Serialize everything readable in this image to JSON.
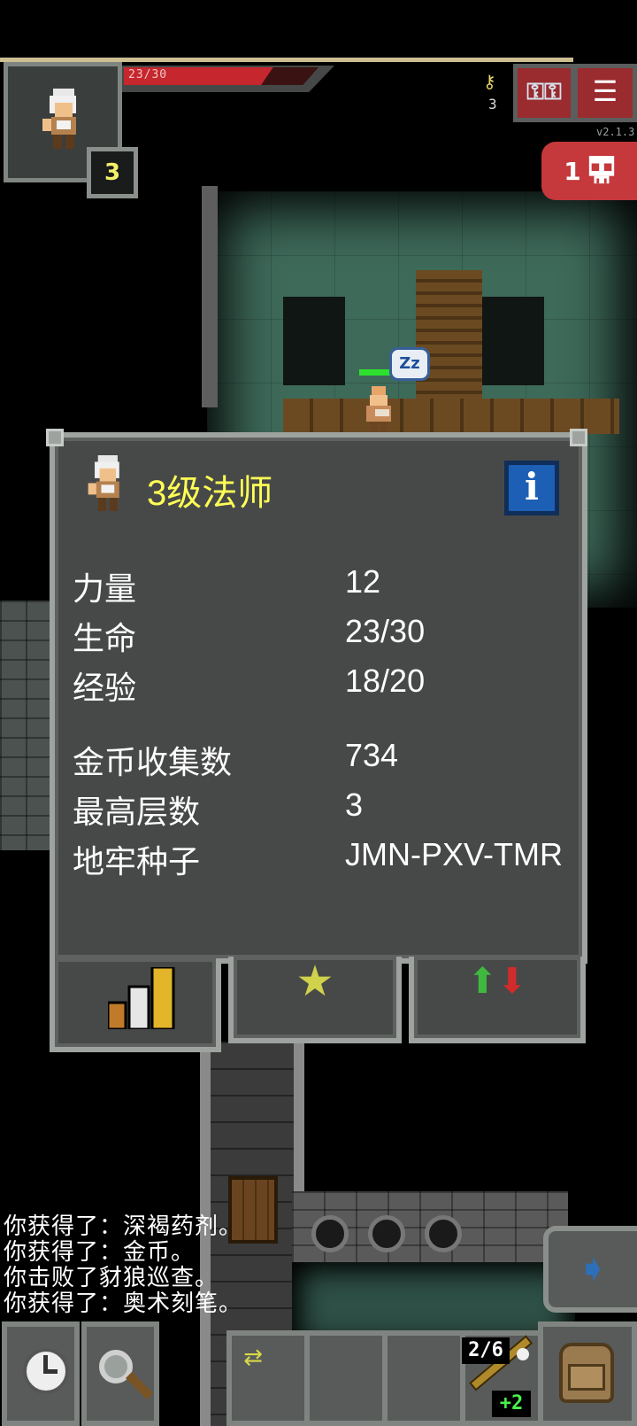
{
  "status": {
    "hp_text": "23/30",
    "hp_current": 23,
    "hp_max": 30,
    "hero_level": "3",
    "keys_count": "3",
    "version": "v2.1.3",
    "danger_count": "1"
  },
  "hero_window": {
    "title": "3级法师",
    "stats": [
      {
        "label": "力量",
        "value": "12"
      },
      {
        "label": "生命",
        "value": "23/30"
      },
      {
        "label": "经验",
        "value": "18/20"
      },
      {
        "label": "金币收集数",
        "value": "734"
      },
      {
        "label": "最高层数",
        "value": "3"
      },
      {
        "label": "地牢种子",
        "value": "JMN-PXV-TMR"
      }
    ],
    "tabs": [
      "stats-tab",
      "talents-tab",
      "buffs-tab"
    ]
  },
  "log": [
    "你获得了：深褐药剂。",
    "你获得了：金币。",
    "你击败了豺狼巡查。",
    "你获得了：奥术刻笔。"
  ],
  "toolbar": {
    "wand_charges": "2/6",
    "wand_bonus": "+2"
  },
  "sleep_bubble": "Zz",
  "icons": {
    "keys": "key-icon",
    "journal": "journal-icon",
    "menu": "menu-icon",
    "danger": "skull-icon",
    "info": "info-icon",
    "wait": "clock-icon",
    "search": "search-icon",
    "swap": "swap-icon",
    "inventory": "backpack-icon",
    "resume": "resume-arrow-icon"
  },
  "colors": {
    "hp": "#c6262d",
    "title": "#ffff55",
    "danger": "#c5383b",
    "info": "#1d5fb5"
  }
}
